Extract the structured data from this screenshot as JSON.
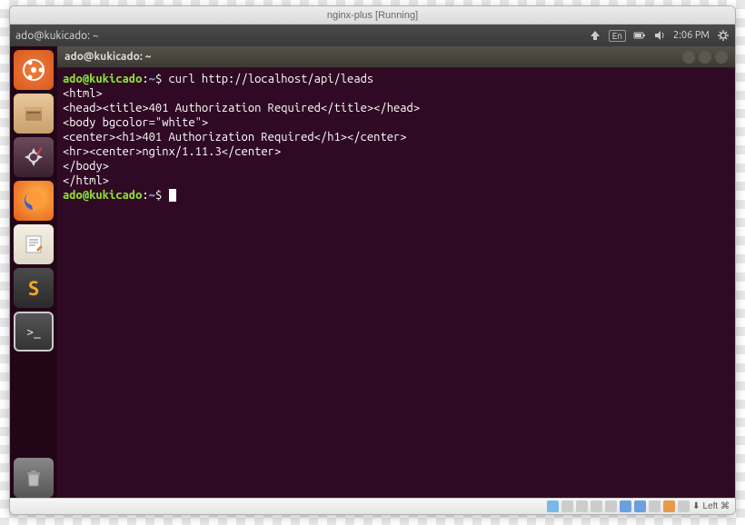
{
  "mac_title": "nginx-plus [Running]",
  "panel": {
    "title": "ado@kukicado: ~",
    "lang": "En",
    "time": "2:06 PM"
  },
  "terminal": {
    "window_title": "ado@kukicado: ~",
    "prompt_user": "ado@kukicado",
    "prompt_path": "~",
    "prompt_symbol": "$",
    "command": "curl http://localhost/api/leads",
    "output_lines": [
      "<html>",
      "<head><title>401 Authorization Required</title></head>",
      "<body bgcolor=\"white\">",
      "<center><h1>401 Authorization Required</h1></center>",
      "<hr><center>nginx/1.11.3</center>",
      "</body>",
      "</html>"
    ]
  },
  "launcher": {
    "items": [
      {
        "name": "dash",
        "glyph": "◐"
      },
      {
        "name": "files",
        "glyph": "🗀"
      },
      {
        "name": "settings",
        "glyph": "⚙"
      },
      {
        "name": "firefox",
        "glyph": "●"
      },
      {
        "name": "gedit",
        "glyph": "✎"
      },
      {
        "name": "sublime",
        "glyph": "S"
      },
      {
        "name": "terminal",
        "glyph": ">_"
      }
    ],
    "trash_glyph": "🗑"
  },
  "statusbar": {
    "host_key": "Left ⌘"
  }
}
